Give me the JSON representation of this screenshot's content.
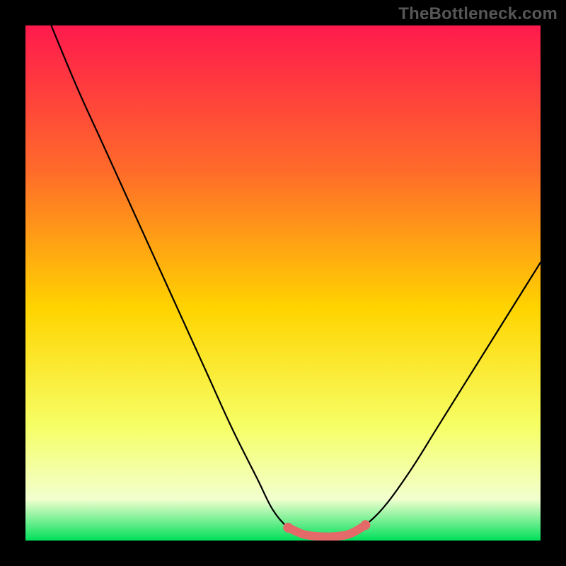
{
  "watermark": "TheBottleneck.com",
  "colors": {
    "frame": "#000000",
    "gradient_top": "#ff1a4d",
    "gradient_upper": "#ff6a2a",
    "gradient_mid": "#ffd400",
    "gradient_lower": "#f6ff66",
    "gradient_pale": "#f2ffcf",
    "gradient_bottom": "#00e05a",
    "curve": "#000000",
    "highlight": "#e46a6a"
  },
  "chart_data": {
    "type": "line",
    "title": "",
    "xlabel": "",
    "ylabel": "",
    "xlim": [
      0,
      100
    ],
    "ylim": [
      0,
      100
    ],
    "grid": false,
    "series": [
      {
        "name": "bottleneck-curve",
        "x": [
          5,
          10,
          15,
          20,
          25,
          30,
          35,
          40,
          45,
          48,
          51,
          54,
          57,
          60,
          63,
          66,
          70,
          75,
          80,
          85,
          90,
          95,
          100
        ],
        "y": [
          100,
          88,
          77,
          66,
          55,
          44,
          33,
          22,
          12,
          6,
          2.5,
          1.2,
          0.8,
          0.8,
          1.3,
          3,
          7,
          14,
          22,
          30,
          38,
          46,
          54
        ]
      }
    ],
    "annotations": [
      {
        "name": "zero-bottleneck-band",
        "x_start": 51,
        "x_end": 66,
        "y": 1.0
      }
    ]
  }
}
